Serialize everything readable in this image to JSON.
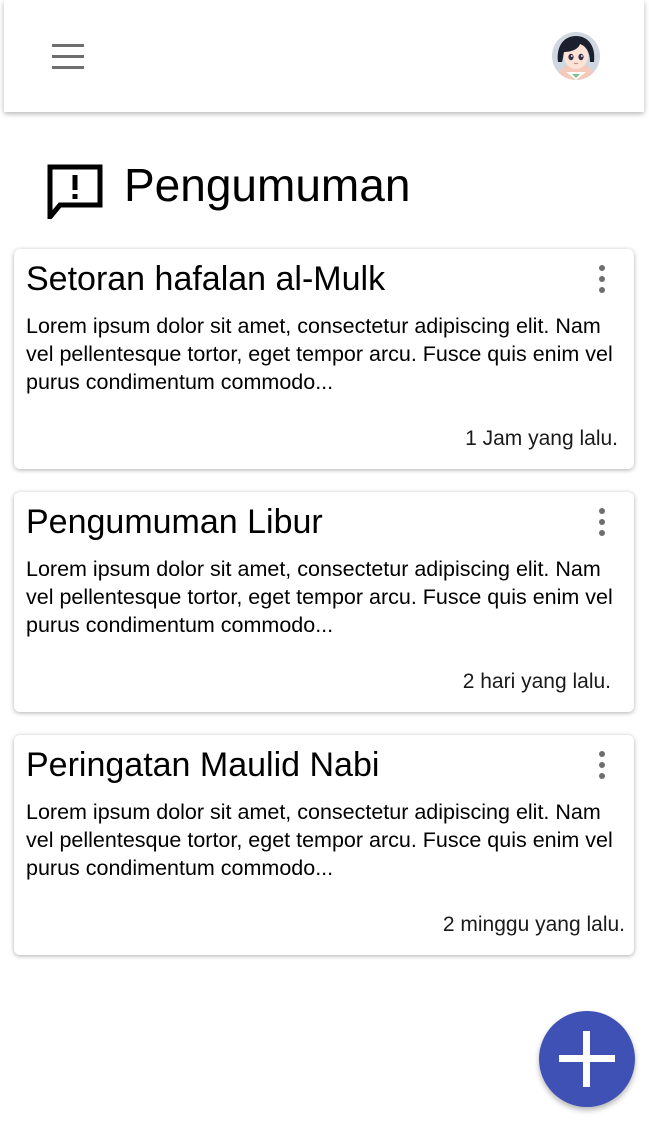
{
  "header": {
    "menu_icon": "hamburger-menu-icon",
    "avatar_icon": "user-avatar"
  },
  "page": {
    "title": "Pengumuman",
    "title_icon": "announcement-icon"
  },
  "announcements": [
    {
      "title": "Setoran hafalan al-Mulk",
      "body": "Lorem ipsum dolor sit amet, consectetur adipiscing elit. Nam vel pellentesque tortor, eget tempor arcu. Fusce quis enim vel purus condimentum commodo...",
      "time": "1 Jam yang lalu."
    },
    {
      "title": "Pengumuman Libur",
      "body": "Lorem ipsum dolor sit amet, consectetur adipiscing elit. Nam vel pellentesque tortor, eget tempor arcu. Fusce quis enim vel purus condimentum commodo...",
      "time": "2 hari yang lalu."
    },
    {
      "title": "Peringatan Maulid Nabi",
      "body": "Lorem ipsum dolor sit amet, consectetur adipiscing elit. Nam vel pellentesque tortor, eget tempor arcu. Fusce quis enim vel purus condimentum commodo...",
      "time": "2 minggu yang lalu."
    }
  ],
  "fab": {
    "icon": "plus-icon"
  },
  "colors": {
    "accent": "#3f51b5",
    "icon_gray": "#6e6e6e"
  }
}
